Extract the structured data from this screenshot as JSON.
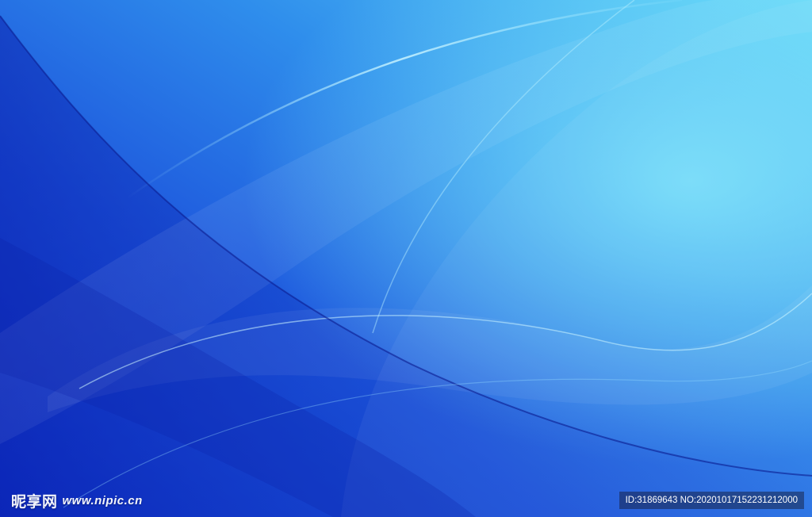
{
  "image": {
    "description_colors": {
      "deep_blue": "#1234c8",
      "mid_blue": "#2a72e6",
      "light_cyan": "#5fd8f8"
    }
  },
  "watermark": {
    "logo_cjk": "昵享网",
    "logo_url": "www.nipic.cn",
    "id_text": "ID:31869643 NO:20201017152231212000"
  }
}
